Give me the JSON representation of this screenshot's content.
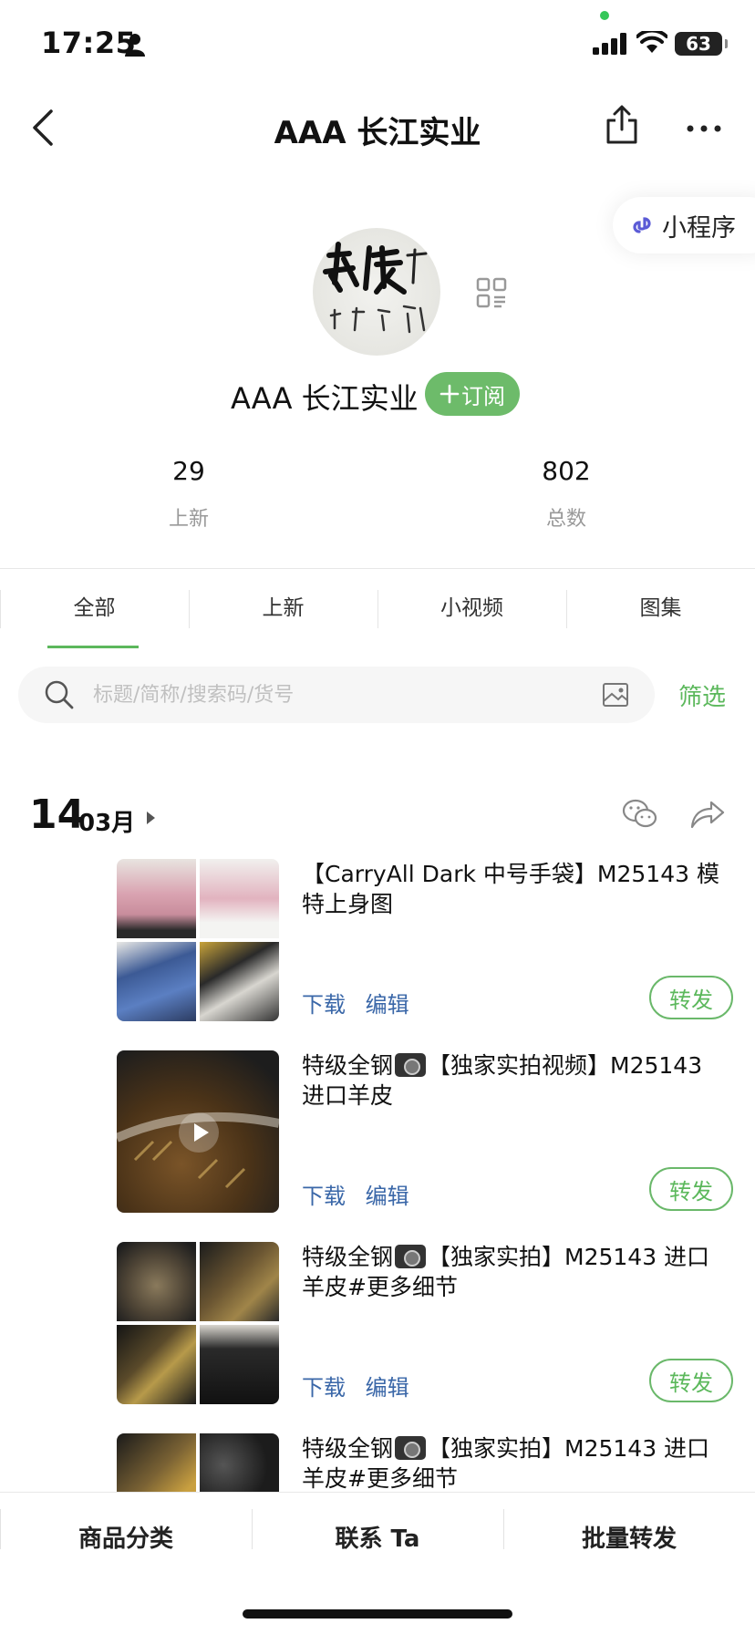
{
  "status_bar": {
    "time": "17:25",
    "battery": "63"
  },
  "nav": {
    "title": "AAA 长江实业"
  },
  "mini_program": {
    "label": "小程序"
  },
  "profile": {
    "name": "AAA 长江实业",
    "subscribe_label": "订阅",
    "stats": [
      {
        "value": "29",
        "label": "上新"
      },
      {
        "value": "802",
        "label": "总数"
      }
    ]
  },
  "tabs": [
    "全部",
    "上新",
    "小视频",
    "图集"
  ],
  "search": {
    "placeholder": "标题/简称/搜索码/货号",
    "filter_label": "筛选"
  },
  "date_group": {
    "day": "14",
    "month": "03月"
  },
  "posts": [
    {
      "title": "【CarryAll Dark 中号手袋】M25143 模特上身图",
      "download": "下载",
      "edit": "编辑",
      "repost": "转发"
    },
    {
      "title_prefix": "特级全钢",
      "title_suffix": "【独家实拍视频】M25143 进口羊皮",
      "download": "下载",
      "edit": "编辑",
      "repost": "转发"
    },
    {
      "title_prefix": "特级全钢",
      "title_suffix": "【独家实拍】M25143 进口羊皮#更多细节",
      "download": "下载",
      "edit": "编辑",
      "repost": "转发"
    },
    {
      "title_prefix": "特级全钢",
      "title_suffix": "【独家实拍】M25143 进口羊皮#更多细节"
    }
  ],
  "bottom_bar": {
    "categories": "商品分类",
    "contact": "联系 Ta",
    "batch_repost": "批量转发"
  },
  "colors": {
    "accent_green": "#5cb85c",
    "link_blue": "#3a67a8"
  }
}
